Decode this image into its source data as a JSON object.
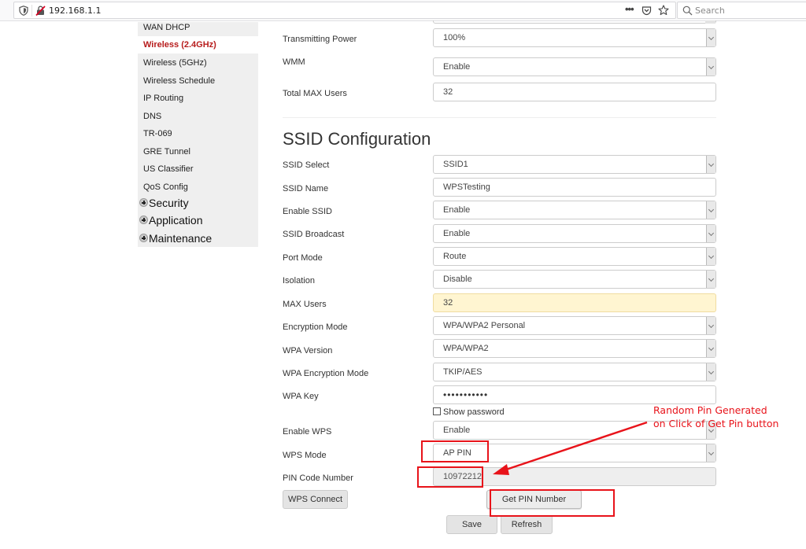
{
  "browser": {
    "url": "192.168.1.1",
    "search_placeholder": "Search",
    "more_label": "•••"
  },
  "sidebar": {
    "items": [
      {
        "label": "WAN DHCP",
        "active": false
      },
      {
        "label": "Wireless (2.4GHz)",
        "active": true
      },
      {
        "label": "Wireless (5GHz)",
        "active": false
      },
      {
        "label": "Wireless Schedule",
        "active": false
      },
      {
        "label": "IP Routing",
        "active": false
      },
      {
        "label": "DNS",
        "active": false
      },
      {
        "label": "TR-069",
        "active": false
      },
      {
        "label": "GRE Tunnel",
        "active": false
      },
      {
        "label": "US Classifier",
        "active": false
      },
      {
        "label": "QoS Config",
        "active": false
      }
    ],
    "groups": [
      {
        "label": "Security"
      },
      {
        "label": "Application"
      },
      {
        "label": "Maintenance"
      }
    ]
  },
  "radio_settings": {
    "transmitting_power": {
      "label": "Transmitting Power",
      "value": "100%"
    },
    "wmm": {
      "label": "WMM",
      "value": "Enable"
    },
    "total_max_users": {
      "label": "Total MAX Users",
      "value": "32"
    }
  },
  "ssid_config": {
    "title": "SSID Configuration",
    "ssid_select": {
      "label": "SSID Select",
      "value": "SSID1"
    },
    "ssid_name": {
      "label": "SSID Name",
      "value": "WPSTesting"
    },
    "enable_ssid": {
      "label": "Enable SSID",
      "value": "Enable"
    },
    "ssid_broadcast": {
      "label": "SSID Broadcast",
      "value": "Enable"
    },
    "port_mode": {
      "label": "Port Mode",
      "value": "Route"
    },
    "isolation": {
      "label": "Isolation",
      "value": "Disable"
    },
    "max_users": {
      "label": "MAX Users",
      "value": "32"
    },
    "encryption_mode": {
      "label": "Encryption Mode",
      "value": "WPA/WPA2 Personal"
    },
    "wpa_version": {
      "label": "WPA Version",
      "value": "WPA/WPA2"
    },
    "wpa_encryption_mode": {
      "label": "WPA Encryption Mode",
      "value": "TKIP/AES"
    },
    "wpa_key": {
      "label": "WPA Key",
      "value": "•••••••••••"
    },
    "show_password": {
      "label": "Show password",
      "checked": false
    },
    "enable_wps": {
      "label": "Enable WPS",
      "value": "Enable"
    },
    "wps_mode": {
      "label": "WPS Mode",
      "value": "AP PIN"
    },
    "pin_code": {
      "label": "PIN Code Number",
      "value": "10972212"
    }
  },
  "buttons": {
    "wps_connect": "WPS Connect",
    "get_pin": "Get PIN Number",
    "save": "Save",
    "refresh": "Refresh"
  },
  "annotation": {
    "line1": "Random Pin Generated",
    "line2": "on Click of Get Pin button",
    "color": "#e8131a"
  }
}
